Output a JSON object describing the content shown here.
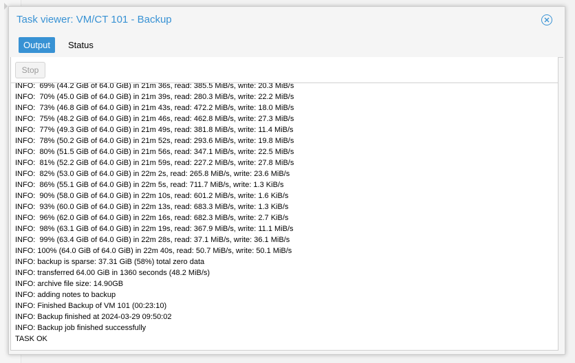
{
  "window": {
    "title": "Task viewer: VM/CT 101 - Backup",
    "accent_color": "#3892d4",
    "close_icon": "close-circle-icon"
  },
  "tabs": [
    {
      "label": "Output",
      "active": true
    },
    {
      "label": "Status",
      "active": false
    }
  ],
  "toolbar": {
    "stop_label": "Stop",
    "stop_disabled": true
  },
  "log": {
    "lines": [
      "INFO:  69% (44.2 GiB of 64.0 GiB) in 21m 36s, read: 385.5 MiB/s, write: 20.3 MiB/s",
      "INFO:  70% (45.0 GiB of 64.0 GiB) in 21m 39s, read: 280.3 MiB/s, write: 22.2 MiB/s",
      "INFO:  73% (46.8 GiB of 64.0 GiB) in 21m 43s, read: 472.2 MiB/s, write: 18.0 MiB/s",
      "INFO:  75% (48.2 GiB of 64.0 GiB) in 21m 46s, read: 462.8 MiB/s, write: 27.3 MiB/s",
      "INFO:  77% (49.3 GiB of 64.0 GiB) in 21m 49s, read: 381.8 MiB/s, write: 11.4 MiB/s",
      "INFO:  78% (50.2 GiB of 64.0 GiB) in 21m 52s, read: 293.6 MiB/s, write: 19.8 MiB/s",
      "INFO:  80% (51.5 GiB of 64.0 GiB) in 21m 56s, read: 347.1 MiB/s, write: 22.5 MiB/s",
      "INFO:  81% (52.2 GiB of 64.0 GiB) in 21m 59s, read: 227.2 MiB/s, write: 27.8 MiB/s",
      "INFO:  82% (53.0 GiB of 64.0 GiB) in 22m 2s, read: 265.8 MiB/s, write: 23.6 MiB/s",
      "INFO:  86% (55.1 GiB of 64.0 GiB) in 22m 5s, read: 711.7 MiB/s, write: 1.3 KiB/s",
      "INFO:  90% (58.0 GiB of 64.0 GiB) in 22m 10s, read: 601.2 MiB/s, write: 1.6 KiB/s",
      "INFO:  93% (60.0 GiB of 64.0 GiB) in 22m 13s, read: 683.3 MiB/s, write: 1.3 KiB/s",
      "INFO:  96% (62.0 GiB of 64.0 GiB) in 22m 16s, read: 682.3 MiB/s, write: 2.7 KiB/s",
      "INFO:  98% (63.1 GiB of 64.0 GiB) in 22m 19s, read: 367.9 MiB/s, write: 11.1 MiB/s",
      "INFO:  99% (63.4 GiB of 64.0 GiB) in 22m 28s, read: 37.1 MiB/s, write: 36.1 MiB/s",
      "INFO: 100% (64.0 GiB of 64.0 GiB) in 22m 40s, read: 50.7 MiB/s, write: 50.1 MiB/s",
      "INFO: backup is sparse: 37.31 GiB (58%) total zero data",
      "INFO: transferred 64.00 GiB in 1360 seconds (48.2 MiB/s)",
      "INFO: archive file size: 14.90GB",
      "INFO: adding notes to backup",
      "INFO: Finished Backup of VM 101 (00:23:10)",
      "INFO: Backup finished at 2024-03-29 09:50:02",
      "INFO: Backup job finished successfully",
      "TASK OK"
    ]
  }
}
